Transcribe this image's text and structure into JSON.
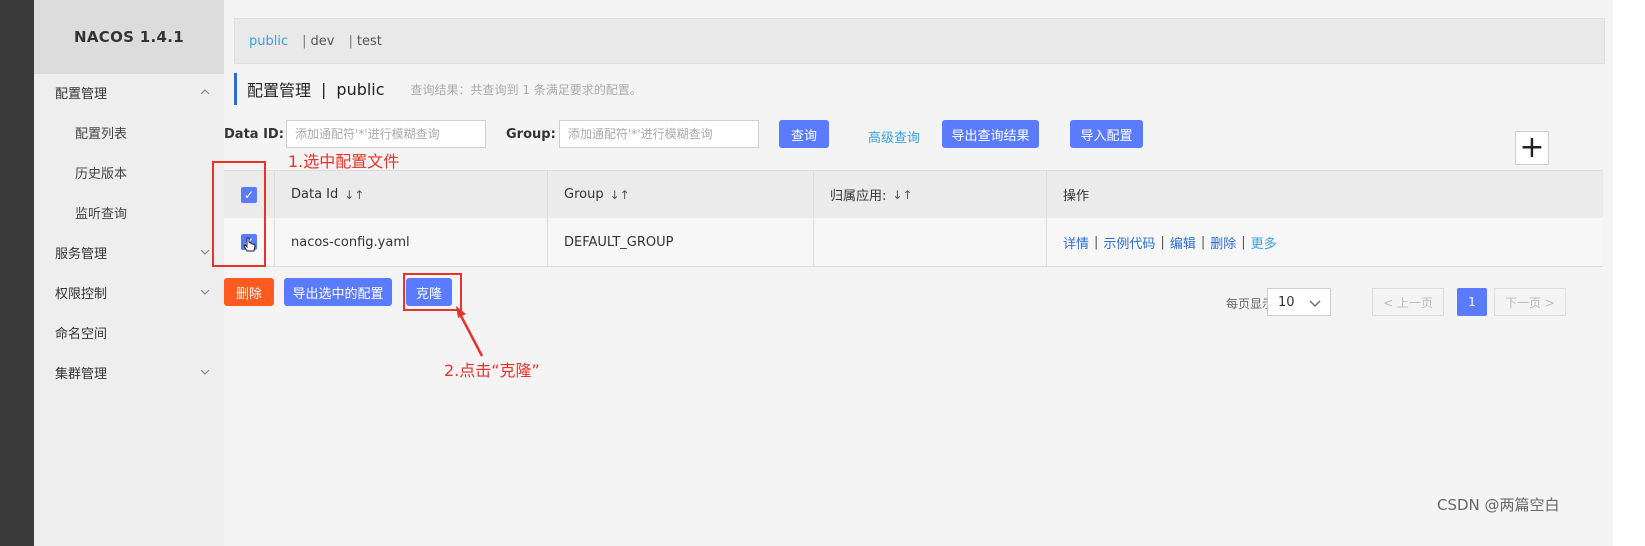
{
  "app": {
    "title": "NACOS 1.4.1"
  },
  "sidebar": {
    "items": [
      {
        "label": "配置管理",
        "expandable": true,
        "expanded": true
      },
      {
        "label": "配置列表",
        "sub": true
      },
      {
        "label": "历史版本",
        "sub": true
      },
      {
        "label": "监听查询",
        "sub": true
      },
      {
        "label": "服务管理",
        "expandable": true,
        "expanded": false
      },
      {
        "label": "权限控制",
        "expandable": true,
        "expanded": false
      },
      {
        "label": "命名空间",
        "expandable": false
      },
      {
        "label": "集群管理",
        "expandable": true,
        "expanded": false
      }
    ]
  },
  "namespaces": {
    "active": "public",
    "items": [
      "public",
      "dev",
      "test"
    ],
    "separator": "|"
  },
  "header": {
    "title": "配置管理",
    "divider": "|",
    "namespace": "public",
    "result_note": "查询结果：共查询到 1 条满足要求的配置。"
  },
  "search": {
    "data_id_label": "Data ID:",
    "data_id_placeholder": "添加通配符'*'进行模糊查询",
    "group_label": "Group:",
    "group_placeholder": "添加通配符'*'进行模糊查询",
    "query_button": "查询",
    "advanced_link": "高级查询",
    "export_results_button": "导出查询结果",
    "import_button": "导入配置",
    "add_button": "+"
  },
  "table": {
    "columns": [
      "Data Id",
      "Group",
      "归属应用:",
      "操作"
    ],
    "sort_icon": "↓↑",
    "rows": [
      {
        "data_id": "nacos-config.yaml",
        "group": "DEFAULT_GROUP",
        "app": "",
        "checked": true
      }
    ],
    "operations": [
      "详情",
      "示例代码",
      "编辑",
      "删除",
      "更多"
    ]
  },
  "bulk": {
    "delete_button": "删除",
    "export_selected_button": "导出选中的配置",
    "clone_button": "克隆"
  },
  "pagination": {
    "page_size_label": "每页显示:",
    "page_size": "10",
    "prev": "< 上一页",
    "current": "1",
    "next": "下一页 >"
  },
  "annotations": {
    "step1": "1.选中配置文件",
    "step2": "2.点击“克隆”",
    "color": "#e8322a"
  },
  "watermark": "CSDN @两篇空白",
  "colors": {
    "primary": "#5b7bff",
    "danger": "#ff5a1f",
    "link": "#3aa0e0"
  },
  "icons": {
    "checkbox": "checkbox-checked-icon",
    "chevron": "chevron-down-icon",
    "cursor": "hand-pointer-icon",
    "sort": "sort-icon",
    "plus": "plus-icon"
  }
}
